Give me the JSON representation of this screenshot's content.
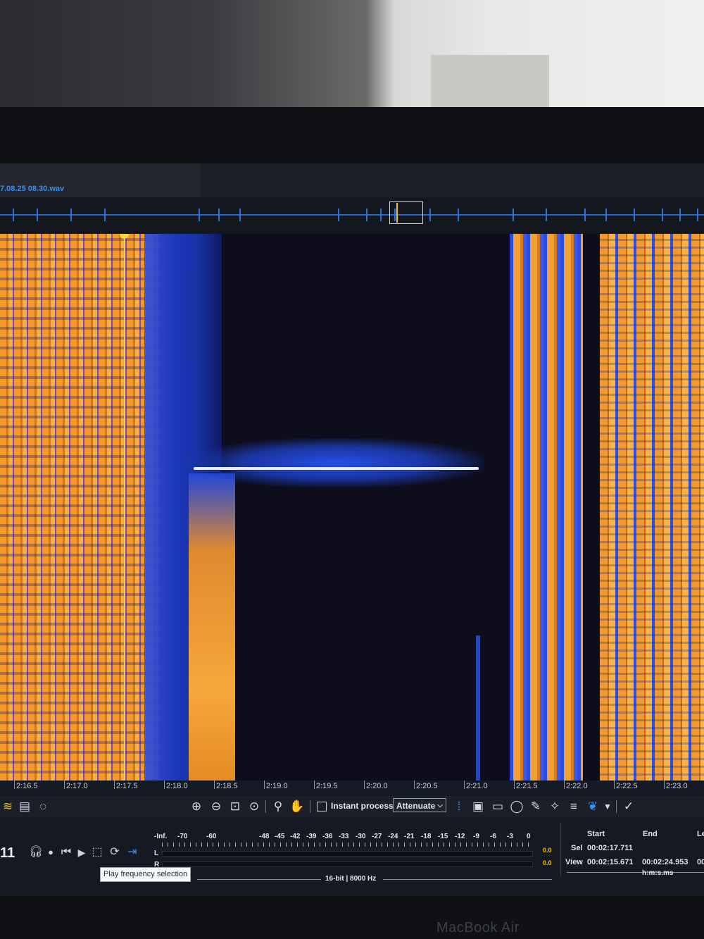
{
  "window": {
    "file_name": "7.08.25 08.30.wav"
  },
  "timeline": {
    "ticks": [
      "2:16.5",
      "2:17.0",
      "2:17.5",
      "2:18.0",
      "2:18.5",
      "2:19.0",
      "2:19.5",
      "2:20.0",
      "2:20.5",
      "2:21.0",
      "2:21.5",
      "2:22.0",
      "2:22.5",
      "2:23.0"
    ]
  },
  "toolbar": {
    "instant_process_label": "Instant process",
    "mode_select": "Attenuate",
    "icons": [
      "zoom-in-icon",
      "zoom-out-icon",
      "zoom-fit-icon",
      "zoom-selection-icon",
      "magnify-icon",
      "hand-icon",
      "time-selection-icon",
      "time-frequency-selection-icon",
      "frequency-selection-icon",
      "lasso-icon",
      "brush-icon",
      "magic-wand-icon",
      "harmonic-selection-icon",
      "waveform-icon",
      "dropdown-icon",
      "pencil-curve-icon"
    ]
  },
  "transport": {
    "counter": "11",
    "tooltip": "Play frequency selection",
    "icons": [
      "headphones-icon",
      "record-icon",
      "skip-back-icon",
      "play-icon",
      "play-frequency-selection-icon",
      "loop-icon",
      "play-to-end-icon"
    ]
  },
  "meter": {
    "scale": [
      "-Inf.",
      "-70",
      "-60",
      "-48",
      "-45",
      "-42",
      "-39",
      "-36",
      "-33",
      "-30",
      "-27",
      "-24",
      "-21",
      "-18",
      "-15",
      "-12",
      "-9",
      "-6",
      "-3",
      "0"
    ],
    "left_label": "L",
    "right_label": "R",
    "left_value": "0.0",
    "right_value": "0.0"
  },
  "status": {
    "format": "16-bit | 8000 Hz"
  },
  "selection": {
    "start_header": "Start",
    "end_header": "End",
    "length_header": "Le",
    "sel_label": "Sel",
    "view_label": "View",
    "sel_start": "00:02:17.711",
    "view_start": "00:02:15.671",
    "view_end": "00:02:24.953",
    "view_extra": "00",
    "time_format": "h:m:s.ms"
  },
  "device": {
    "brand": "MacBook Air"
  }
}
